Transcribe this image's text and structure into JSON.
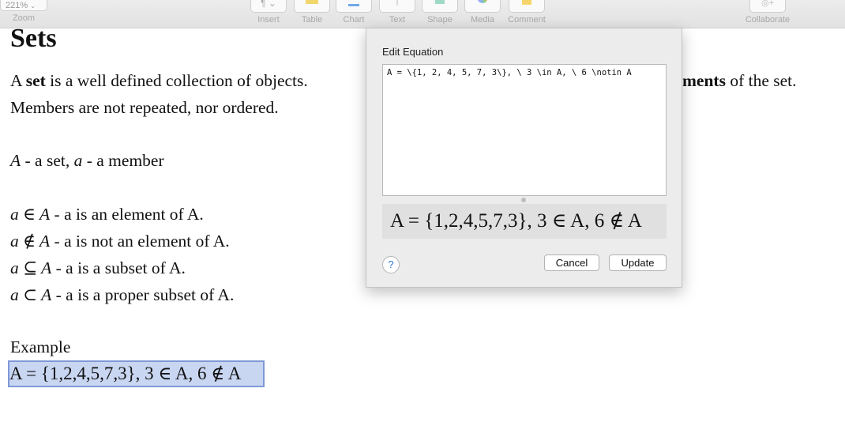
{
  "toolbar": {
    "zoom_value": "221%",
    "zoom_label": "Zoom",
    "insert_label": "Insert",
    "table_label": "Table",
    "chart_label": "Chart",
    "text_label": "Text",
    "shape_label": "Shape",
    "media_label": "Media",
    "comment_label": "Comment",
    "collaborate_label": "Collaborate"
  },
  "doc": {
    "title": "Sets",
    "p1_a": "A ",
    "p1_b": "set",
    "p1_c": " is a well defined collection of objects.",
    "p1_d": "ments",
    "p1_e": " of the set.",
    "p2": "Members are not repeated, nor ordered.",
    "p3_A": "A",
    "p3_mid": " - a set, ",
    "p3_a": "a",
    "p3_end": " - a member",
    "rel1_sym": "a ∈ A",
    "rel1_text": " - a is an element of A.",
    "rel2_sym": "a ∉ A",
    "rel2_text": " - a is not an element of A.",
    "rel3_sym": "a ⊆ A",
    "rel3_text": " - a is a subset of A.",
    "rel4_sym": "a ⊂ A",
    "rel4_text": " - a is a proper subset of A.",
    "example_label": "Example",
    "example_eq": "A = {1,2,4,5,7,3}, 3 ∈ A, 6 ∉ A"
  },
  "dialog": {
    "title": "Edit Equation",
    "latex": "A = \\{1, 2, 4, 5, 7, 3\\}, \\ 3 \\in A, \\ 6 \\notin A",
    "preview": "A = {1,2,4,5,7,3}, 3 ∈ A, 6 ∉ A",
    "help": "?",
    "cancel": "Cancel",
    "update": "Update"
  }
}
